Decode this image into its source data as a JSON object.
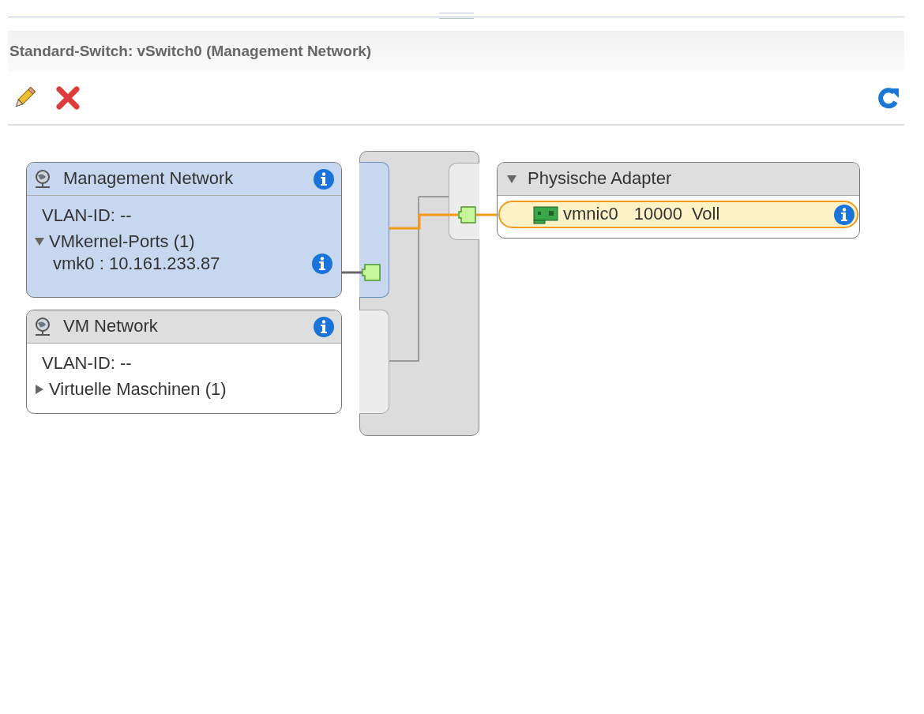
{
  "title": "Standard-Switch: vSwitch0 (Management Network)",
  "port_groups": [
    {
      "name": "Management Network",
      "selected": true,
      "vlan": "VLAN-ID: --",
      "section": {
        "label": "VMkernel-Ports (1)",
        "expanded": true,
        "items": [
          "vmk0 : 10.161.233.87"
        ]
      }
    },
    {
      "name": "VM Network",
      "selected": false,
      "vlan": "VLAN-ID: --",
      "section": {
        "label": "Virtuelle Maschinen (1)",
        "expanded": false
      }
    }
  ],
  "adapters": {
    "label": "Physische Adapter",
    "expanded": true,
    "items": [
      {
        "name": "vmnic0",
        "speed": "10000",
        "duplex": "Voll",
        "selected": true
      }
    ]
  }
}
